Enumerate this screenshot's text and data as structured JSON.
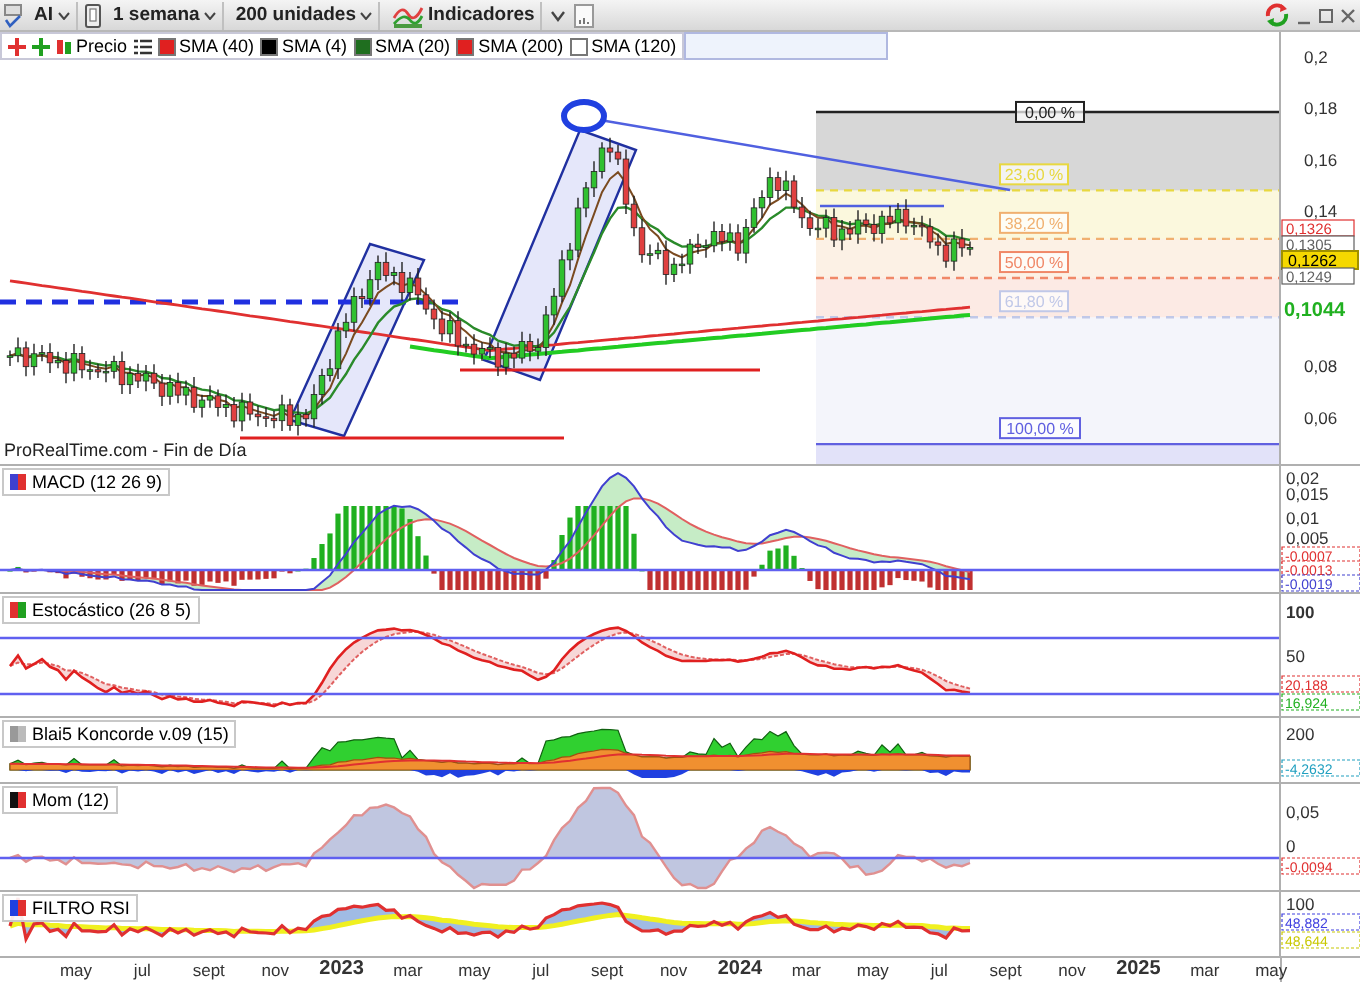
{
  "toolbar": {
    "symbol": "AI",
    "period": "1 semana",
    "units": "200 unidades",
    "indicators": "Indicadores"
  },
  "legend": [
    {
      "label": "Precio",
      "kind": "price"
    },
    {
      "label": "SMA (40)",
      "kind": "swatch",
      "color": "#e02020"
    },
    {
      "label": "SMA (4)",
      "kind": "swatch",
      "color": "#000000"
    },
    {
      "label": "SMA (20)",
      "kind": "swatch",
      "color": "#1f6e1f"
    },
    {
      "label": "SMA (200)",
      "kind": "swatch",
      "color": "#e02020"
    },
    {
      "label": "SMA (120)",
      "kind": "swatch",
      "color": "#ffffff"
    }
  ],
  "main": {
    "source": "ProRealTime.com - Fin de Día",
    "axis": [
      "0,2",
      "0,18",
      "0,16",
      "0,14",
      "0,08",
      "0,06"
    ],
    "fib_levels": [
      {
        "label": "0,00 %",
        "color": "#222222"
      },
      {
        "label": "23,60 %",
        "color": "#e8d840"
      },
      {
        "label": "38,20 %",
        "color": "#f0b070"
      },
      {
        "label": "50,00 %",
        "color": "#f08868"
      },
      {
        "label": "61,80 %",
        "color": "#c0c8e8"
      },
      {
        "label": "100,00 %",
        "color": "#6060e0"
      }
    ],
    "price_tags": [
      {
        "text": "0,1326",
        "kind": "plain",
        "color": "#e03030"
      },
      {
        "text": "0,1305",
        "kind": "plain",
        "color": "#606060"
      },
      {
        "text": "0,1262",
        "kind": "current",
        "color": "#000000"
      },
      {
        "text": "0,1249",
        "kind": "plain",
        "color": "#606060"
      },
      {
        "text": "0,1044",
        "kind": "average",
        "color": "#20b020"
      }
    ]
  },
  "panels": [
    {
      "kind": "macd",
      "title": "MACD (12 26 9)",
      "axis": [
        "0,02",
        "0,015",
        "0,01",
        "0,005"
      ],
      "tags": [
        {
          "text": "-0,0007",
          "color": "#e03030"
        },
        {
          "text": "-0,0013",
          "color": "#e03030"
        },
        {
          "text": "-0,0019",
          "color": "#4040d0"
        }
      ]
    },
    {
      "kind": "stochastic",
      "title": "Estocástico (26 8 5)",
      "axis": [
        "100",
        "50"
      ],
      "tags": [
        {
          "text": "20,188",
          "color": "#e03030"
        },
        {
          "text": "16,924",
          "color": "#20b020"
        }
      ]
    },
    {
      "kind": "koncorde",
      "title": "Blai5 Koncorde v.09 (15)",
      "axis": [
        "200"
      ],
      "tags": [
        {
          "text": "-4,2632",
          "color": "#20a0c0"
        }
      ]
    },
    {
      "kind": "momentum",
      "title": "Mom (12)",
      "axis": [
        "0,05",
        "0"
      ],
      "tags": [
        {
          "text": "-0,0094",
          "color": "#e03030"
        }
      ]
    },
    {
      "kind": "rsi",
      "title": "FILTRO RSI",
      "axis": [
        "100"
      ],
      "tags": [
        {
          "text": "48,882",
          "color": "#4040e0"
        },
        {
          "text": "48,644",
          "color": "#c8c800"
        }
      ]
    }
  ],
  "time_axis": [
    {
      "label": "may",
      "kind": "month"
    },
    {
      "label": "jul",
      "kind": "month"
    },
    {
      "label": "sept",
      "kind": "month"
    },
    {
      "label": "nov",
      "kind": "month"
    },
    {
      "label": "2023",
      "kind": "year"
    },
    {
      "label": "mar",
      "kind": "month"
    },
    {
      "label": "may",
      "kind": "month"
    },
    {
      "label": "jul",
      "kind": "month"
    },
    {
      "label": "sept",
      "kind": "month"
    },
    {
      "label": "nov",
      "kind": "month"
    },
    {
      "label": "2024",
      "kind": "year"
    },
    {
      "label": "mar",
      "kind": "month"
    },
    {
      "label": "may",
      "kind": "month"
    },
    {
      "label": "jul",
      "kind": "month"
    },
    {
      "label": "sept",
      "kind": "month"
    },
    {
      "label": "nov",
      "kind": "month"
    },
    {
      "label": "2025",
      "kind": "year"
    },
    {
      "label": "mar",
      "kind": "month"
    },
    {
      "label": "may",
      "kind": "month"
    }
  ]
}
